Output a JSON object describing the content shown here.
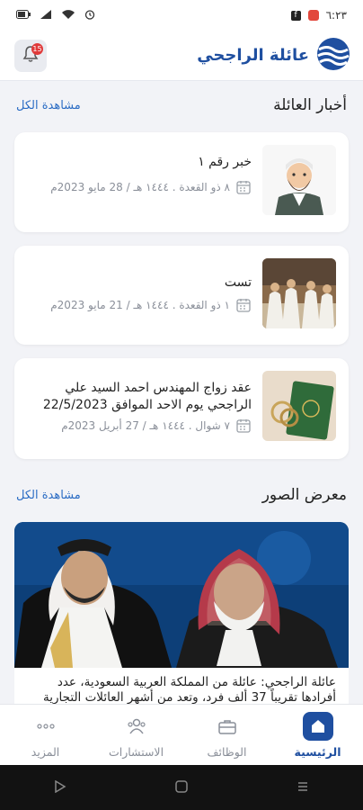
{
  "status": {
    "time": "٦:٢٣"
  },
  "header": {
    "brand_name": "عائلة الراجحي",
    "notification_count": "15"
  },
  "news_section": {
    "title": "أخبار العائلة",
    "see_all": "مشاهدة الكل",
    "items": [
      {
        "title": "خبر رقم ١",
        "date": "٨ ذو القعدة . ١٤٤٤ هـ / 28 مايو 2023م"
      },
      {
        "title": "تست",
        "date": "١ ذو القعدة . ١٤٤٤ هـ / 21 مايو 2023م"
      },
      {
        "title": "عقد زواج المهندس احمد السيد علي الراجحي يوم الاحد الموافق 22/5/2023",
        "date": "٧ شوال . ١٤٤٤ هـ / 27 أبريل 2023م"
      }
    ]
  },
  "gallery_section": {
    "title": "معرض الصور",
    "see_all": "مشاهدة الكل",
    "caption": "عائلة الراجحي: عائلة من المملكة العربية السعودية، عدد أفرادها تقريباً 37 ألف فرد، وتعد من أشهر العائلات التجارية"
  },
  "bottom_nav": {
    "home": "الرئيسية",
    "jobs": "الوظائف",
    "consultations": "الاستشارات",
    "more": "المزيد"
  },
  "colors": {
    "brand": "#1f4fa0",
    "link": "#2b6cc4",
    "background": "#f2f3f7"
  }
}
